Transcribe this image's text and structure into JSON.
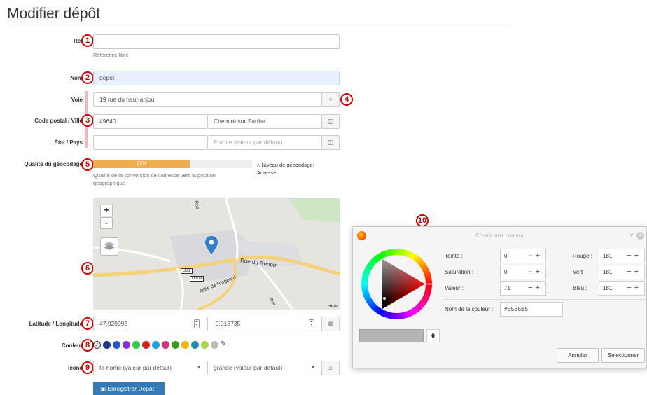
{
  "page": {
    "title": "Modifier dépôt"
  },
  "badges": [
    "1",
    "2",
    "3",
    "4",
    "5",
    "6",
    "7",
    "8",
    "9",
    "10"
  ],
  "form": {
    "ref": {
      "label": "Ref",
      "value": "",
      "help": "Référence libre"
    },
    "nom": {
      "label": "Nom",
      "value": "dépôt"
    },
    "voie": {
      "label": "Voie",
      "value": "19 rue du haut-anjou"
    },
    "cp_ville": {
      "label": "Code postal / Ville",
      "code": "49640",
      "ville": "Chemiré sur Sarthe"
    },
    "etat_pays": {
      "label": "État / Pays",
      "etat": "",
      "pays_placeholder": "France (valeur par défaut)"
    },
    "geocode": {
      "label": "Qualité du géocodage",
      "percent": 61,
      "percent_text": "61%",
      "help": "Qualité de la conversion de l'adresse vers la position géographique",
      "level_label": "Niveau de géocodage:",
      "level_value": "Adresse"
    },
    "map": {
      "zoom_in": "+",
      "zoom_out": "-",
      "labels": [
        "Rue du Renom",
        "D31",
        "D309",
        "Allée de Ringeard",
        "Rue",
        "Rue"
      ],
      "attribution": "Here"
    },
    "latlon": {
      "label": "Latitude / Longitude",
      "lat": "47,929093",
      "lon": "-0,018735"
    },
    "couleur": {
      "label": "Couleur",
      "swatches": [
        "#ffffff",
        "#1a3a8f",
        "#2355d8",
        "#8a2be2",
        "#2ecc40",
        "#e01b1b",
        "#1ea1e6",
        "#d63384",
        "#3d9b1b",
        "#f5b800",
        "#1f8fb0",
        "#a8d84a",
        "#bdbdbd"
      ]
    },
    "icone": {
      "label": "Icône",
      "icon_value": "fa-home (valeur par défaut)",
      "size_value": "grande (valeur par défaut)"
    },
    "save_label": "Enregistrer Dépôt"
  },
  "dialog": {
    "title": "Choisir une couleur",
    "teinte": {
      "label": "Teinte :",
      "value": "0"
    },
    "saturation": {
      "label": "Saturation :",
      "value": "0"
    },
    "valeur": {
      "label": "Valeur :",
      "value": "71"
    },
    "rouge": {
      "label": "Rouge :",
      "value": "181"
    },
    "vert": {
      "label": "Vert :",
      "value": "181"
    },
    "bleu": {
      "label": "Bleu :",
      "value": "181"
    },
    "name_label": "Nom de la couleur :",
    "name_value": "#B5B5B5",
    "current_color": "#b5b5b5",
    "cancel": "Annuler",
    "select": "Sélectionner"
  }
}
